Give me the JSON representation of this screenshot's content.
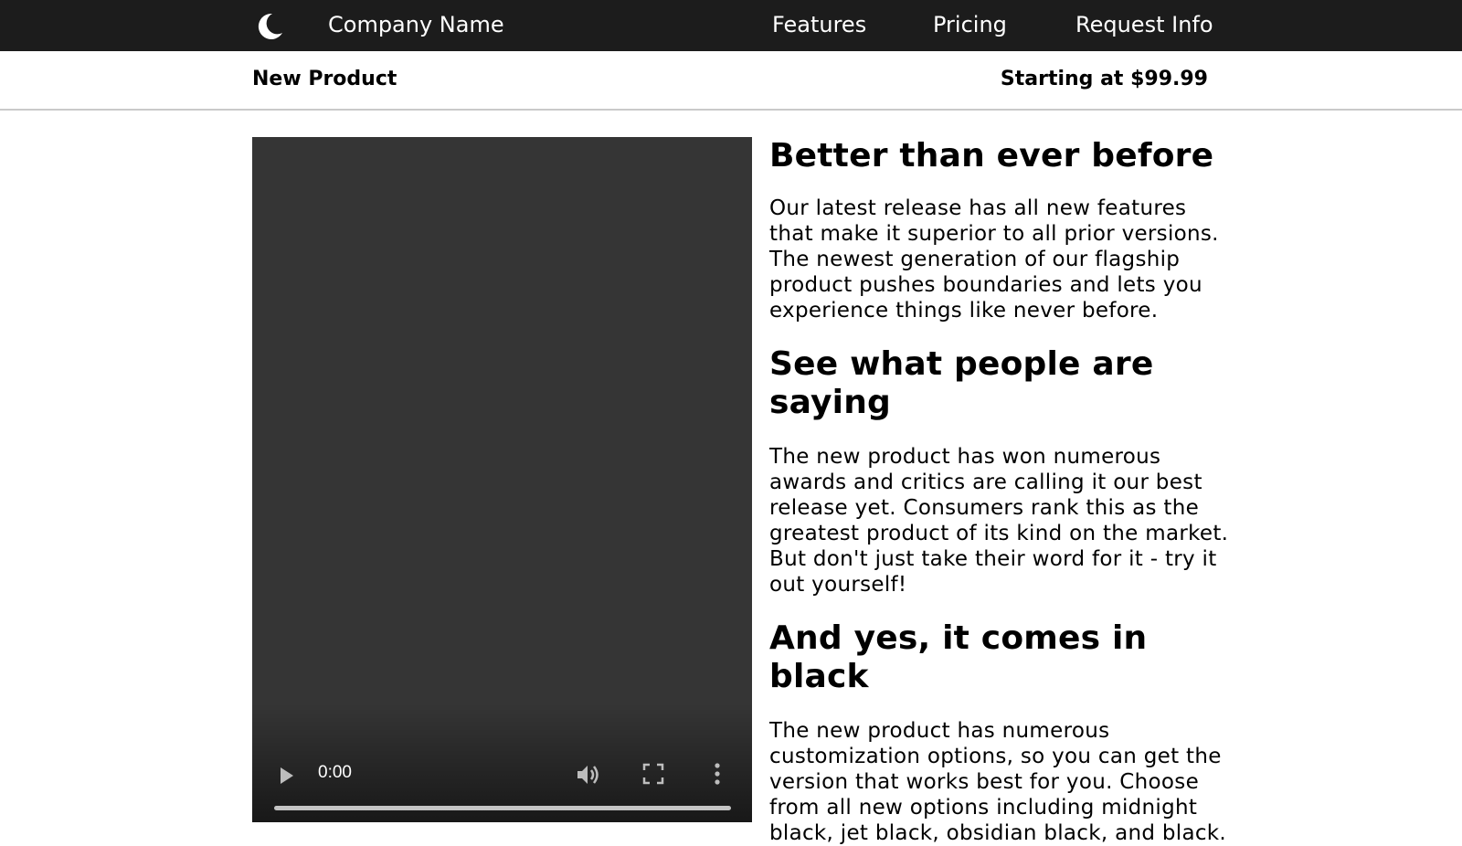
{
  "header": {
    "logo_icon": "crescent-moon-icon",
    "company_name": "Company Name",
    "nav_items": [
      "Features",
      "Pricing",
      "Request Info"
    ],
    "background_color": "#1c1c1c"
  },
  "subheader": {
    "product_name": "New Product",
    "price_text": "Starting at $99.99"
  },
  "video": {
    "current_time": "0:00",
    "progress": 0,
    "controls": [
      "play-icon",
      "volume-icon",
      "fullscreen-icon",
      "more-options-icon"
    ]
  },
  "content": {
    "sections": [
      {
        "heading": "Better than ever before",
        "body": "Our latest release has all new features that make it superior to all prior versions. The newest generation of our flagship product pushes boundaries and lets you experience things like never before."
      },
      {
        "heading": "See what people are saying",
        "body": "The new product has won numerous awards and critics are calling it our best release yet. Consumers rank this as the greatest product of its kind on the market. But don't just take their word for it - try it out yourself!"
      },
      {
        "heading": "And yes, it comes in black",
        "body": "The new product has numerous customization options, so you can get the version that works best for you. Choose from all new options including midnight black, jet black, obsidian black, and black."
      }
    ]
  }
}
